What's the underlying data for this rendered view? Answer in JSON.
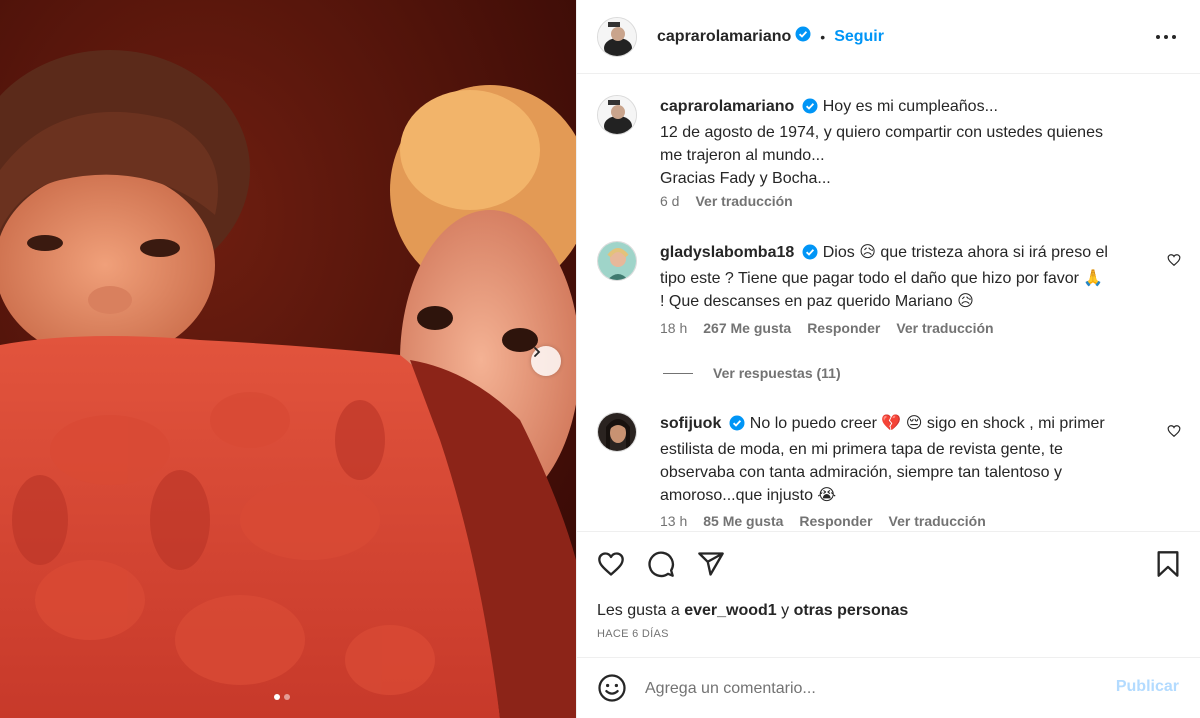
{
  "post": {
    "username": "caprarolamariano",
    "follow_label": "Seguir",
    "separator": "•",
    "caption_lines": [
      "Hoy es mi cumpleaños...",
      "12 de agosto de 1974, y quiero compartir con ustedes quienes",
      "me trajeron al mundo...",
      "Gracias Fady y Bocha..."
    ],
    "caption_time": "6 d",
    "caption_translate": "Ver traducción"
  },
  "comments": [
    {
      "username": "gladyslabomba18",
      "text_lines": [
        "Dios 😥 que tristeza ahora si irá preso el",
        "tipo este ? Tiene que pagar todo el daño que hizo por favor 🙏",
        "! Que descanses en paz querido Mariano 😥"
      ],
      "time": "18 h",
      "likes": "267 Me gusta",
      "reply": "Responder",
      "translate": "Ver traducción"
    },
    {
      "username": "sofijuok",
      "text_lines": [
        "No lo puedo creer 💔 😔 sigo en shock , mi primer",
        "estilista de moda, en mi primera tapa de revista gente, te",
        "observaba con tanta admiración, siempre tan talentoso y",
        "amoroso...que injusto 😭"
      ],
      "time": "13 h",
      "likes": "85 Me gusta",
      "reply": "Responder",
      "translate": "Ver traducción"
    }
  ],
  "replies_label": "Ver respuestas (11)",
  "likes": {
    "prefix": "Les gusta a",
    "user": "ever_wood1",
    "mid": "y",
    "rest": "otras personas"
  },
  "posted_ago": "HACE 6 DÍAS",
  "comment_box": {
    "placeholder": "Agrega un comentario...",
    "publish_label": "Publicar"
  },
  "carousel": {
    "slide": 1,
    "total": 2
  },
  "colors": {
    "accent": "#0095f6",
    "publish_disabled": "#b3dbff",
    "verified": "#0095f6"
  }
}
